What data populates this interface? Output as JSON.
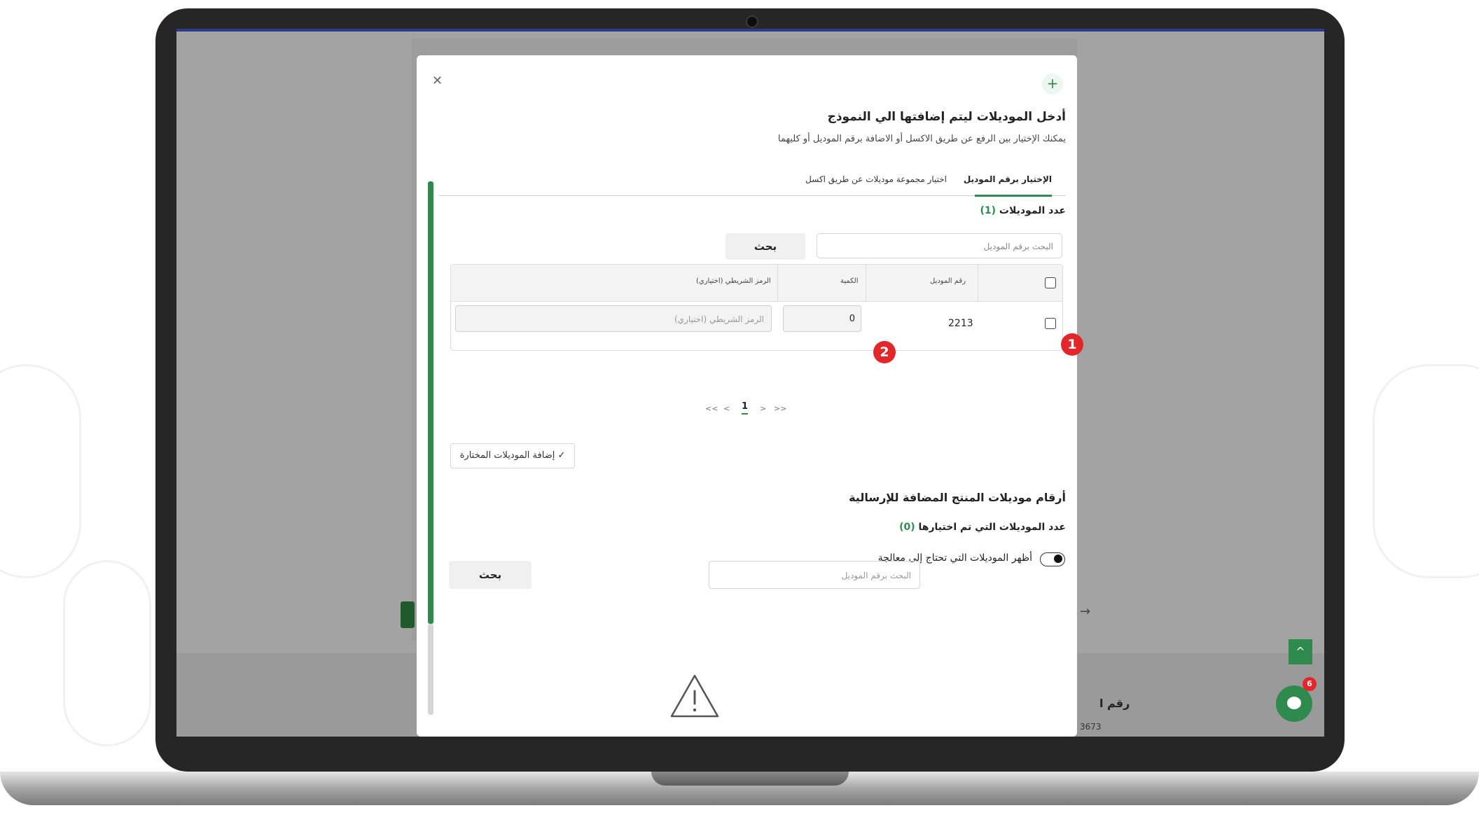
{
  "modal": {
    "close_icon": "close-icon",
    "plus_icon": "plus-icon",
    "title": "أدخل الموديلات ليتم إضافتها الي النموذج",
    "subtitle": "يمكنك الإختيار بين الرفع عن طريق الاكسل أو الاضافة برقم الموديل أو كليهما",
    "tabs": [
      {
        "label": "الإختيار برقم الموديل",
        "active": true
      },
      {
        "label": "اختيار مجموعة موديلات عن طريق اكسل",
        "active": false
      }
    ],
    "models_count": {
      "label": "عدد الموديلات",
      "value": "(1)"
    },
    "search": {
      "placeholder": "البحث برقم الموديل",
      "button": "بحث"
    },
    "table": {
      "headers": {
        "model_number": "رقم الموديل",
        "quantity": "الكمية",
        "barcode": "الرمز الشريطي (اختياري)"
      },
      "rows": [
        {
          "model_number": "2213",
          "quantity": "0",
          "barcode_placeholder": "الرمز الشريطي (اختياري)"
        }
      ]
    },
    "pagination": {
      "first": "<<",
      "prev": "<",
      "current": "1",
      "next": ">",
      "last": ">>"
    },
    "add_selected_button": "✓ إضافة الموديلات المختارة",
    "section2": {
      "title": "أرقام موديلات المنتج المضافة للإرسالية",
      "selected_count": {
        "label": "عدد الموديلات التي تم اختيارها",
        "value": "(0)"
      },
      "toggle_label": "أظهر الموديلات التي تحتاج إلى معالجة",
      "toggle_on": true,
      "search": {
        "placeholder": "البحث برقم الموديل",
        "button": "بحث"
      }
    }
  },
  "annotations": {
    "badge_1": "1",
    "badge_2": "2"
  },
  "background": {
    "footer_label": "رقم ا",
    "footer_number": "3673",
    "arrow": "→"
  },
  "widgets": {
    "scroll_top": "^",
    "chat_badge": "6"
  },
  "colors": {
    "accent": "#2e8b4d",
    "badge": "#e3262a",
    "overlay": "#a3a3a3"
  }
}
